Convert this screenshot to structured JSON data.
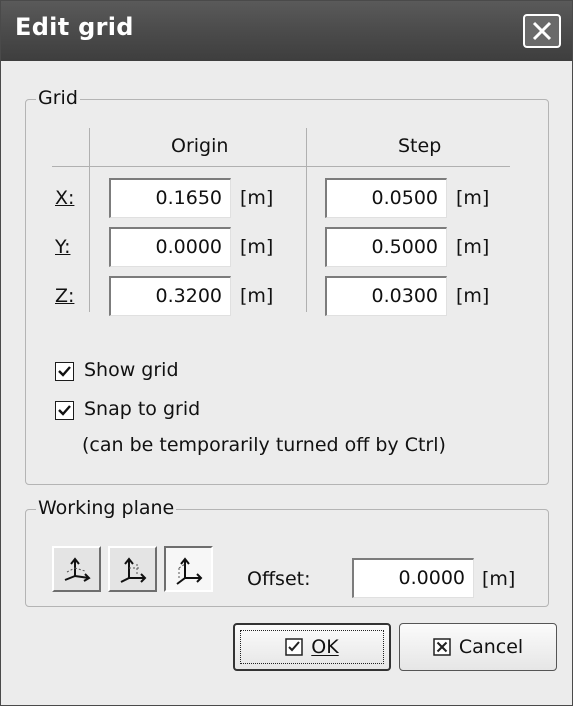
{
  "window": {
    "title": "Edit grid"
  },
  "grid": {
    "legend": "Grid",
    "columns": {
      "origin": "Origin",
      "step": "Step"
    },
    "rows": [
      {
        "axis": "X:",
        "origin": "0.1650",
        "origin_unit": "[m]",
        "step": "0.0500",
        "step_unit": "[m]"
      },
      {
        "axis": "Y:",
        "origin": "0.0000",
        "origin_unit": "[m]",
        "step": "0.5000",
        "step_unit": "[m]"
      },
      {
        "axis": "Z:",
        "origin": "0.3200",
        "origin_unit": "[m]",
        "step": "0.0300",
        "step_unit": "[m]"
      }
    ],
    "show_grid": {
      "label": "Show grid",
      "checked": true
    },
    "snap_to_grid": {
      "label": "Snap to grid",
      "checked": true,
      "note": "(can be temporarily turned off by Ctrl)"
    }
  },
  "working_plane": {
    "legend": "Working plane",
    "plane_buttons": [
      {
        "icon": "axes-plane-xy-icon",
        "active": false
      },
      {
        "icon": "axes-plane-xz-icon",
        "active": false
      },
      {
        "icon": "axes-plane-yz-icon",
        "active": true
      }
    ],
    "offset_label": "Offset:",
    "offset_value": "0.0000",
    "offset_unit": "[m]"
  },
  "buttons": {
    "ok": {
      "label": "OK",
      "icon": "checkbox-checked-icon"
    },
    "cancel": {
      "label": "Cancel",
      "icon": "checkbox-x-icon"
    }
  },
  "colors": {
    "titlebar": "#4b4b4b",
    "dialog_bg": "#ececec",
    "field_bg": "#ffffff"
  }
}
